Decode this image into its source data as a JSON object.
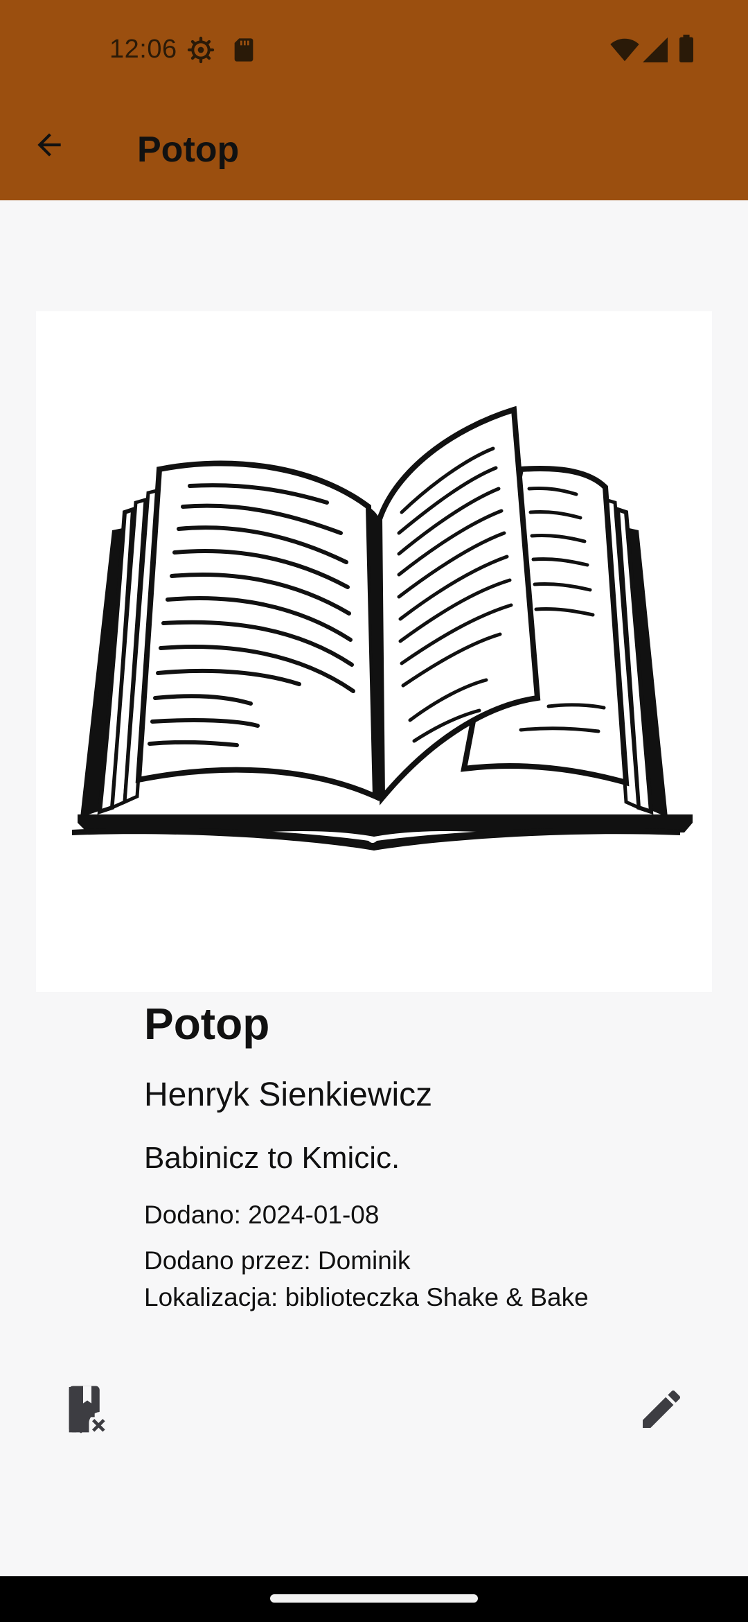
{
  "status_bar": {
    "time": "12:06",
    "icons": [
      "settings-icon",
      "sd-card-icon",
      "wifi-icon",
      "signal-icon",
      "battery-icon"
    ]
  },
  "toolbar": {
    "title": "Potop",
    "back_icon": "arrow-back-icon"
  },
  "book": {
    "title": "Potop",
    "author": "Henryk Sienkiewicz",
    "description": "Babinicz to Kmicic.",
    "added": "Dodano: 2024-01-08",
    "added_by": "Dodano przez: Dominik",
    "location": "Lokalizacja: biblioteczka Shake & Bake",
    "cover_icon": "open-book-illustration"
  },
  "actions": {
    "remove_icon": "bookmark-remove-icon",
    "edit_icon": "pencil-icon"
  },
  "colors": {
    "appbar": "#9b4f0f",
    "background": "#f7f7f8",
    "icon": "#3d3d42"
  }
}
